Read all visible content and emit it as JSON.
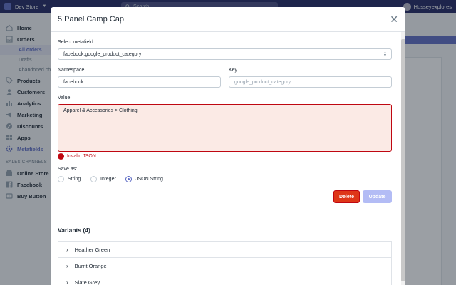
{
  "topbar": {
    "store_name": "Dev Store",
    "search_placeholder": "Search",
    "user_name": "Husseyexplores"
  },
  "sidebar": {
    "items": [
      {
        "label": "Home",
        "icon": "home-icon"
      },
      {
        "label": "Orders",
        "icon": "orders-icon"
      },
      {
        "label": "Products",
        "icon": "tag-icon"
      },
      {
        "label": "Customers",
        "icon": "customers-icon"
      },
      {
        "label": "Analytics",
        "icon": "analytics-icon"
      },
      {
        "label": "Marketing",
        "icon": "marketing-icon"
      },
      {
        "label": "Discounts",
        "icon": "discount-icon"
      },
      {
        "label": "Apps",
        "icon": "apps-icon"
      },
      {
        "label": "Metafields",
        "icon": "gear-icon"
      }
    ],
    "order_subitems": [
      "All orders",
      "Drafts",
      "Abandoned checkouts"
    ],
    "channels_title": "SALES CHANNELS",
    "channels": [
      {
        "label": "Online Store",
        "icon": "store-icon"
      },
      {
        "label": "Facebook",
        "icon": "facebook-icon"
      },
      {
        "label": "Buy Button",
        "icon": "buy-button-icon"
      }
    ]
  },
  "modal": {
    "title": "5 Panel Camp Cap",
    "select_label": "Select metafield",
    "select_value": "facebook.google_product_category",
    "namespace_label": "Namespace",
    "namespace_value": "facebook",
    "key_label": "Key",
    "key_placeholder": "google_product_category",
    "value_label": "Value",
    "value_text": "Apparel & Accessories > Clothing",
    "error_text": "Invalid JSON",
    "save_as_label": "Save as:",
    "save_options": [
      "String",
      "Integer",
      "JSON String"
    ],
    "save_selected": "JSON String",
    "delete_label": "Delete",
    "update_label": "Update",
    "variants_title": "Variants (4)",
    "variants": [
      "Heather Green",
      "Burnt Orange",
      "Slate Grey"
    ]
  },
  "colors": {
    "topbar": "#1c2260",
    "accent": "#5c6ac4",
    "error": "#bf0711",
    "error_bg": "#fbeae5",
    "delete": "#de3618",
    "update_disabled": "#b3bcf5"
  }
}
